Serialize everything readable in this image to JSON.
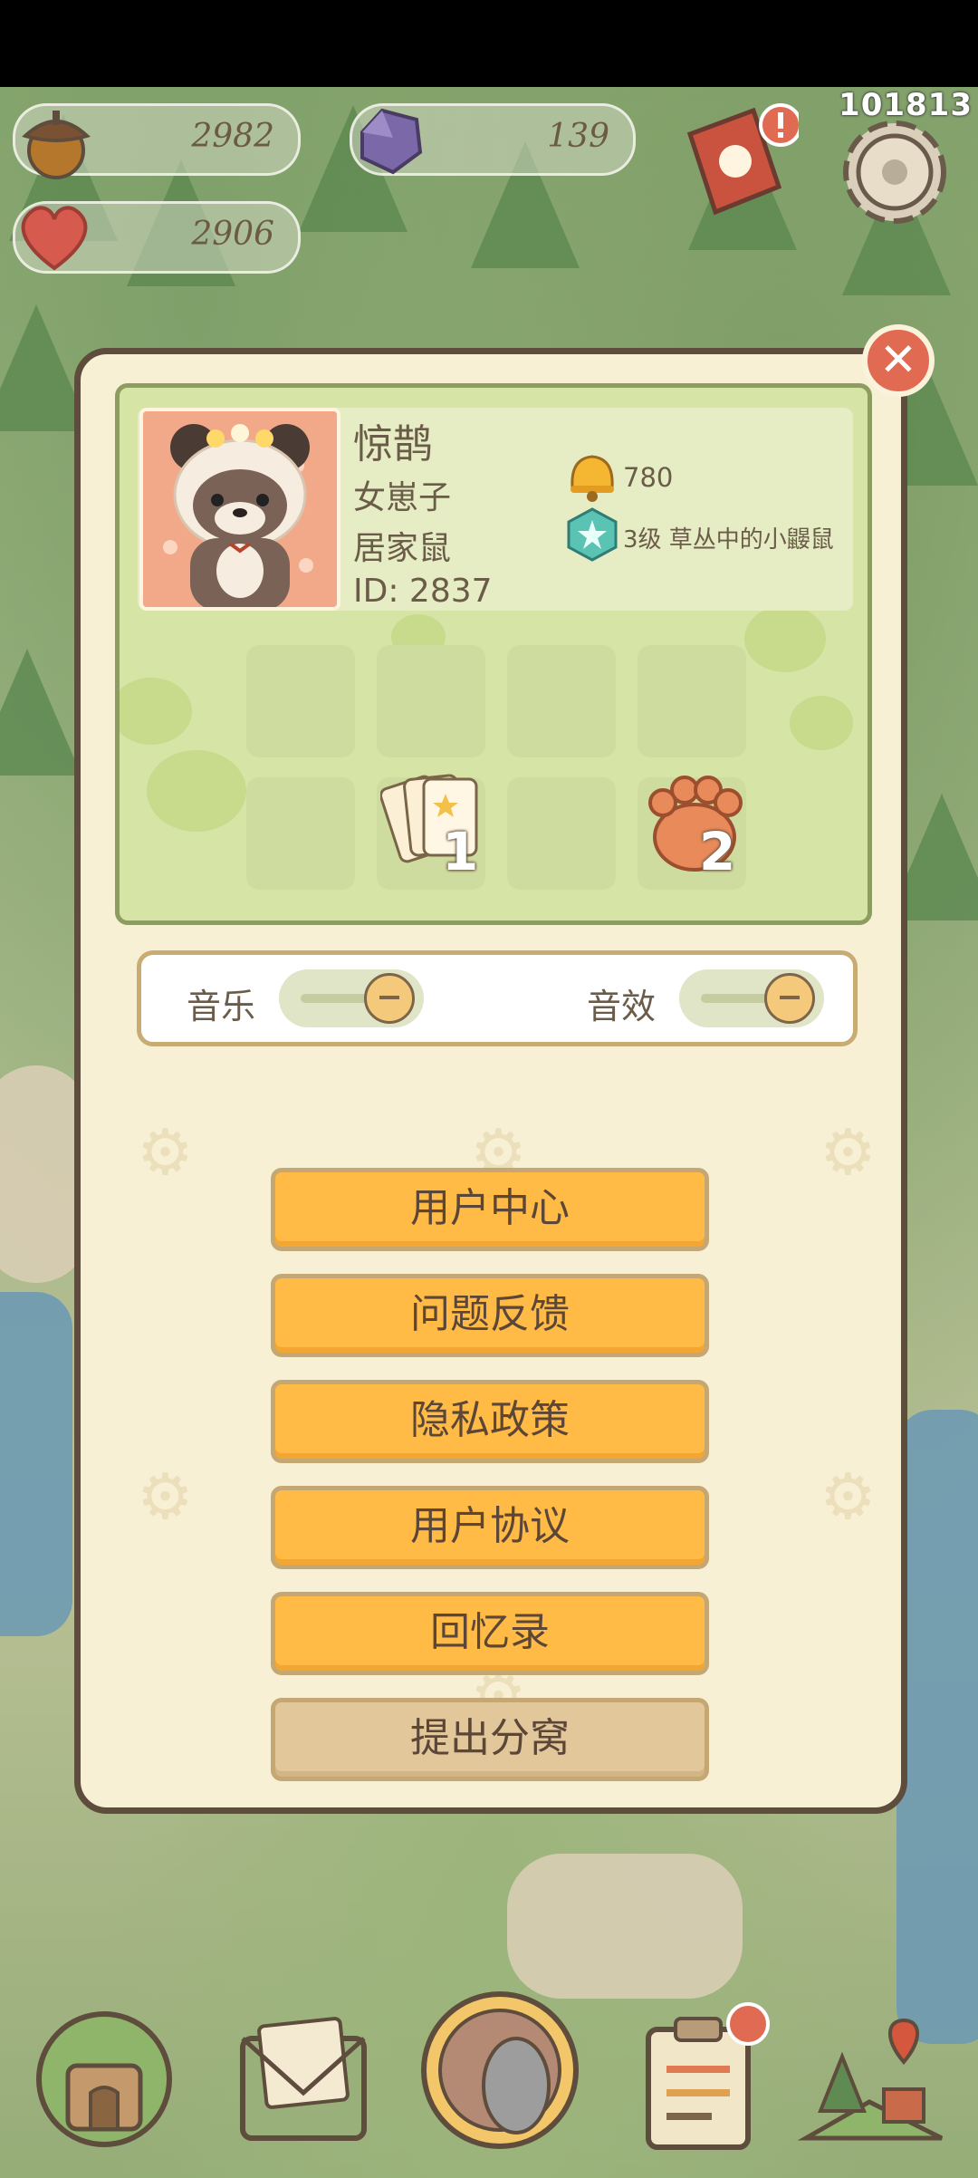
{
  "hud": {
    "acorns": "2982",
    "gems": "139",
    "hearts": "2906",
    "code": "101813"
  },
  "profile": {
    "name": "惊鹊",
    "line1": "女崽子",
    "line2": "居家鼠",
    "id_text": "ID: 2837",
    "bells": "780",
    "level": "3级 草丛中的小鼹鼠",
    "items": [
      {
        "icon": "cards-icon",
        "count": "1"
      },
      {
        "icon": "paw-icon",
        "count": "2"
      }
    ]
  },
  "settings": {
    "music_label": "音乐",
    "sfx_label": "音效"
  },
  "menu": [
    {
      "label": "用户中心"
    },
    {
      "label": "问题反馈"
    },
    {
      "label": "隐私政策"
    },
    {
      "label": "用户协议"
    },
    {
      "label": "回忆录"
    },
    {
      "label": "提出分窝"
    }
  ],
  "colors": {
    "panel_bg": "#f8f0d4",
    "button": "#ffbb45",
    "button_alt": "#e1c79a",
    "close": "#e06a52"
  }
}
